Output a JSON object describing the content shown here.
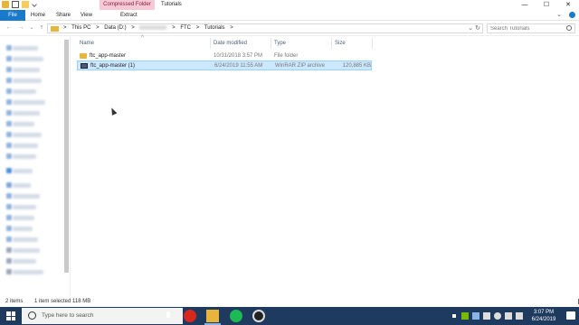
{
  "window": {
    "context_tab": "Compressed Folder Tools",
    "title": "Tutorials",
    "minimize": "—",
    "maximize": "☐",
    "close": "✕"
  },
  "ribbon": {
    "tabs": [
      "File",
      "Home",
      "Share",
      "View",
      "Extract"
    ],
    "expand": "⌄"
  },
  "address": {
    "crumbs": [
      "This PC",
      "Data (D:)",
      "FTC",
      "Tutorials"
    ],
    "separator": ">",
    "dropdown": "⌄",
    "refresh": "↻"
  },
  "search": {
    "placeholder": "Search Tutorials"
  },
  "nav": {
    "back": "←",
    "forward": "→",
    "recent": "⌄",
    "up": "↑"
  },
  "columns": {
    "name": "Name",
    "date": "Date modified",
    "type": "Type",
    "size": "Size",
    "sort_caret": "^"
  },
  "files": [
    {
      "name": "ftc_app-master",
      "date": "10/31/2018 3:57 PM",
      "type": "File folder",
      "size": "",
      "icon": "folder-icon",
      "selected": false
    },
    {
      "name": "ftc_app-master (1)",
      "date": "6/24/2019 11:55 AM",
      "type": "WinRAR ZIP archive",
      "size": "120,885 KB",
      "icon": "zip-archive-icon",
      "selected": true
    }
  ],
  "status": {
    "count": "2 items",
    "selection": "1 item selected  118 MB"
  },
  "taskbar": {
    "search_placeholder": "Type here to search",
    "time": "3:07 PM",
    "date": "6/24/2019"
  },
  "colors": {
    "accent": "#1979ca",
    "selection": "#cce8ff",
    "taskbar": "#1f3a5f",
    "context_tab": "#f6c9d6"
  }
}
